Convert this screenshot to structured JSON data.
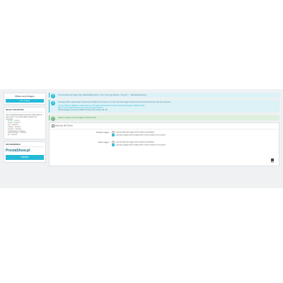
{
  "sidebar": {
    "title": "Pillow Lazy Images",
    "tab_label": "Lazy Images",
    "image_converter": {
      "heading": "IMAGE CONVERTER",
      "description": "List of supported image converters with status on your server. You must enable at least one converter.",
      "converters": [
        {
          "label": "vwebp - enabled",
          "enabled": true
        },
        {
          "label": "ffmpeg - disabled",
          "enabled": false
        },
        {
          "label": "cwp - disabled",
          "enabled": false
        },
        {
          "label": "imagick - disabled",
          "enabled": false
        },
        {
          "label": "gmagick - disabled",
          "enabled": false
        },
        {
          "label": "imagemagick - disabled",
          "enabled": false
        },
        {
          "label": "graphicsmagick - disabled",
          "enabled": false
        },
        {
          "label": "gd - disabled",
          "enabled": false
        }
      ]
    },
    "recommended": {
      "heading": "RECOMMENDED",
      "logo_main": "PrestaShow",
      "logo_tld": ".pl",
      "button_label": "ORDERS"
    }
  },
  "alerts": [
    {
      "type": "info",
      "icon": "question-icon",
      "text": "You can ignore any image using \"data-disabled-ignore\" in the <img> tag. Example: <img src=\"...\" data-disabled-ignore>"
    },
    {
      "type": "info",
      "icon": "question-icon",
      "text": "All images will be dynamically converted from WebP at the moment, you must check all image formats and remove them whenever they are converted.",
      "lines": [
        "You can add the <IfModule> redirect rule in your hosting control panel to convert all product images to WebP format:",
        "Add it in your .htaccess file at the root of your store directory.",
        "Product images converted to WebP format by this module: 68 / 68"
      ]
    },
    {
      "type": "ok",
      "icon": "check-icon",
      "text": "Module is ready to convert images to WebP format."
    }
  ],
  "form": {
    "heading": "MODULE SETTINGS",
    "rows": [
      {
        "label": "Product images",
        "options": [
          {
            "text": "Load normally (all images will be loaded immediately)",
            "checked": false
          },
          {
            "text": "Load lazy (images will be loaded when it will be visible on the screen)",
            "checked": true
          }
        ]
      },
      {
        "label": "Other images",
        "options": [
          {
            "text": "Load normally (all images will be loaded immediately)",
            "checked": false
          },
          {
            "text": "Load lazy (images will be loaded when it will be visible on the screen)",
            "checked": true
          }
        ]
      }
    ],
    "save_label": "Save"
  },
  "colors": {
    "accent": "#25b9d7",
    "success": "#70b580",
    "background": "#eff1f2"
  }
}
